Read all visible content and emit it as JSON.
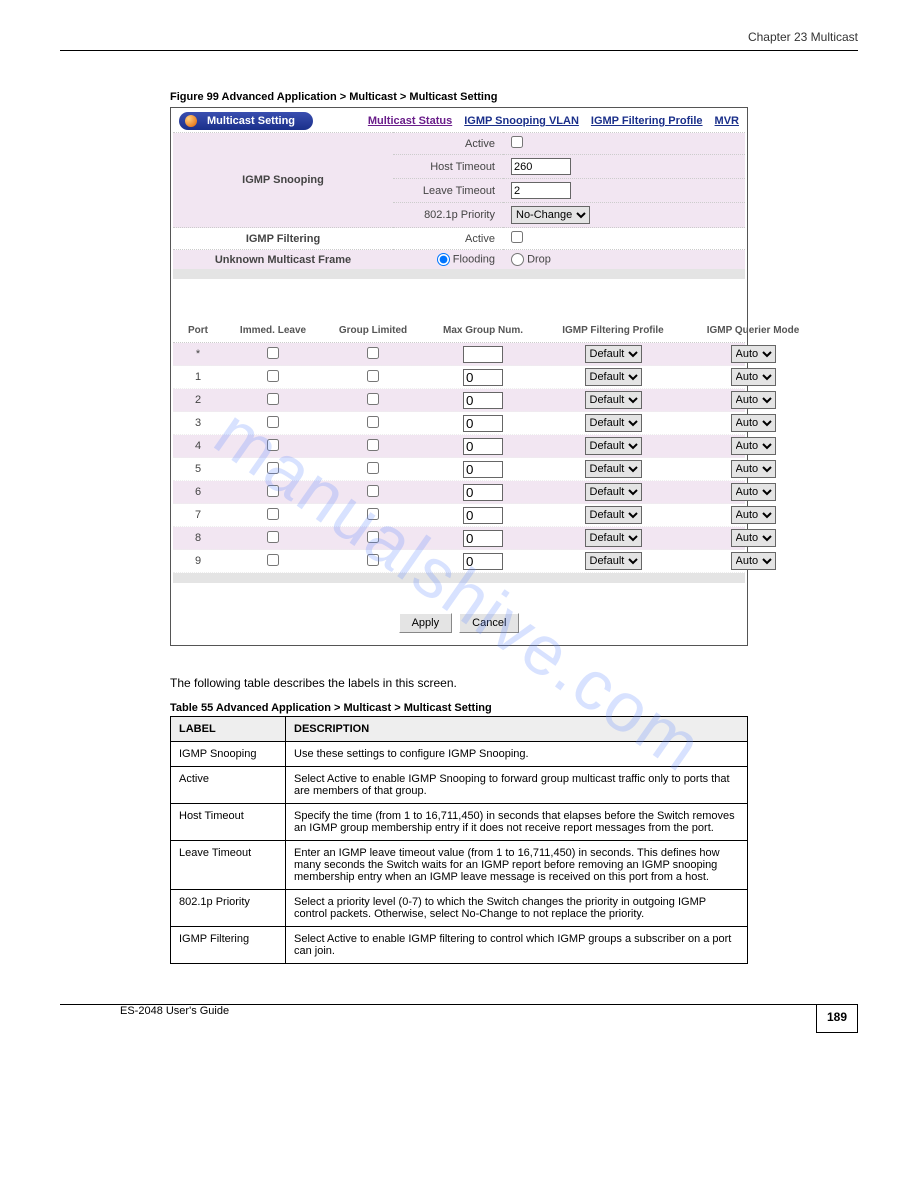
{
  "header": {
    "chapter": "Chapter 23 Multicast",
    "figure": "Figure 99   Advanced Application > Multicast > Multicast Setting"
  },
  "panel": {
    "title": "Multicast Setting",
    "nav": [
      {
        "label": "Multicast Status",
        "visited": true
      },
      {
        "label": "IGMP Snooping VLAN",
        "visited": false
      },
      {
        "label": "IGMP Filtering Profile",
        "visited": false
      },
      {
        "label": "MVR",
        "visited": false
      }
    ]
  },
  "settings": {
    "igmp_snooping_label": "IGMP Snooping",
    "active_label": "Active",
    "host_timeout_label": "Host Timeout",
    "host_timeout_value": "260",
    "leave_timeout_label": "Leave Timeout",
    "leave_timeout_value": "2",
    "priority_label": "802.1p Priority",
    "priority_value": "No-Change",
    "igmp_filtering_label": "IGMP Filtering",
    "unknown_frame_label": "Unknown Multicast Frame",
    "flooding_label": "Flooding",
    "drop_label": "Drop"
  },
  "port_table": {
    "headers": {
      "port": "Port",
      "immed": "Immed. Leave",
      "group": "Group Limited",
      "max": "Max Group Num.",
      "profile": "IGMP Filtering Profile",
      "mode": "IGMP Querier Mode"
    },
    "rows": [
      {
        "port": "*",
        "max": "",
        "profile": "Default",
        "mode": "Auto"
      },
      {
        "port": "1",
        "max": "0",
        "profile": "Default",
        "mode": "Auto"
      },
      {
        "port": "2",
        "max": "0",
        "profile": "Default",
        "mode": "Auto"
      },
      {
        "port": "3",
        "max": "0",
        "profile": "Default",
        "mode": "Auto"
      },
      {
        "port": "4",
        "max": "0",
        "profile": "Default",
        "mode": "Auto"
      },
      {
        "port": "5",
        "max": "0",
        "profile": "Default",
        "mode": "Auto"
      },
      {
        "port": "6",
        "max": "0",
        "profile": "Default",
        "mode": "Auto"
      },
      {
        "port": "7",
        "max": "0",
        "profile": "Default",
        "mode": "Auto"
      },
      {
        "port": "8",
        "max": "0",
        "profile": "Default",
        "mode": "Auto"
      },
      {
        "port": "9",
        "max": "0",
        "profile": "Default",
        "mode": "Auto"
      }
    ],
    "profile_select": "Default",
    "mode_select": "Auto"
  },
  "buttons": {
    "apply": "Apply",
    "cancel": "Cancel"
  },
  "doc": {
    "intro": "The following table describes the labels in this screen.",
    "table_title": "Table 55   Advanced Application > Multicast > Multicast Setting",
    "th_label": "LABEL",
    "th_desc": "DESCRIPTION",
    "rows": [
      {
        "label": "IGMP Snooping",
        "desc": "Use these settings to configure IGMP Snooping."
      },
      {
        "label": "Active",
        "desc": "Select Active to enable IGMP Snooping to forward group multicast traffic only to ports that are members of that group."
      },
      {
        "label": "Host Timeout",
        "desc": "Specify the time (from 1 to 16,711,450) in seconds that elapses before the Switch removes an IGMP group membership entry if it does not receive report messages from the port."
      },
      {
        "label": "Leave Timeout",
        "desc": "Enter an IGMP leave timeout value (from 1 to 16,711,450) in seconds. This defines how many seconds the Switch waits for an IGMP report before removing an IGMP snooping membership entry when an IGMP leave message is received on this port from a host."
      },
      {
        "label": "802.1p Priority",
        "desc": "Select a priority level (0-7) to which the Switch changes the priority in outgoing IGMP control packets. Otherwise, select No-Change to not replace the priority."
      },
      {
        "label": "IGMP Filtering",
        "desc": "Select Active to enable IGMP filtering to control which IGMP groups a subscriber on a port can join."
      }
    ]
  },
  "footer": {
    "guide": "ES-2048 User's Guide",
    "page": "189"
  },
  "watermark": "manualshive.com"
}
